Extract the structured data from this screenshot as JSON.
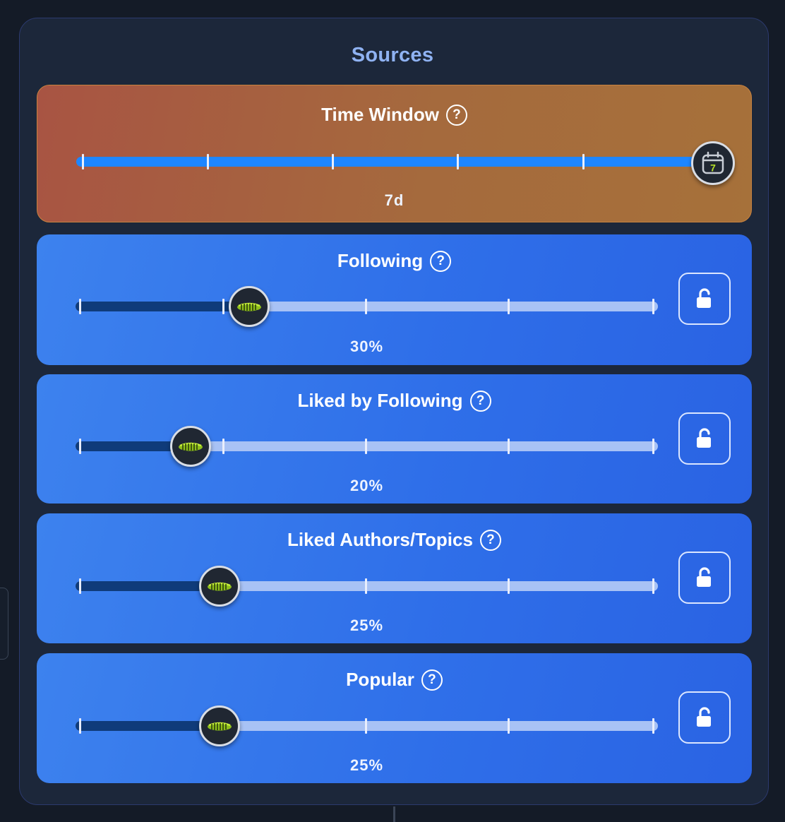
{
  "panel": {
    "title": "Sources"
  },
  "time_window": {
    "title": "Time Window",
    "value_label": "7d",
    "value_fraction": 1.0,
    "thumb_icon": "calendar-icon",
    "calendar_day": "7"
  },
  "sources": [
    {
      "title": "Following",
      "value_label": "30%",
      "value_fraction": 0.3,
      "locked": false
    },
    {
      "title": "Liked by Following",
      "value_label": "20%",
      "value_fraction": 0.2,
      "locked": false
    },
    {
      "title": "Liked Authors/Topics",
      "value_label": "25%",
      "value_fraction": 0.25,
      "locked": false
    },
    {
      "title": "Popular",
      "value_label": "25%",
      "value_fraction": 0.25,
      "locked": false
    }
  ],
  "icons": {
    "help": "?",
    "slider_thumb": "caterpillar-icon",
    "lock": "unlocked-icon"
  },
  "colors": {
    "time_track": "#1e86ff",
    "source_fill": "#0f3b7a",
    "source_track": "#a8c2f5"
  }
}
